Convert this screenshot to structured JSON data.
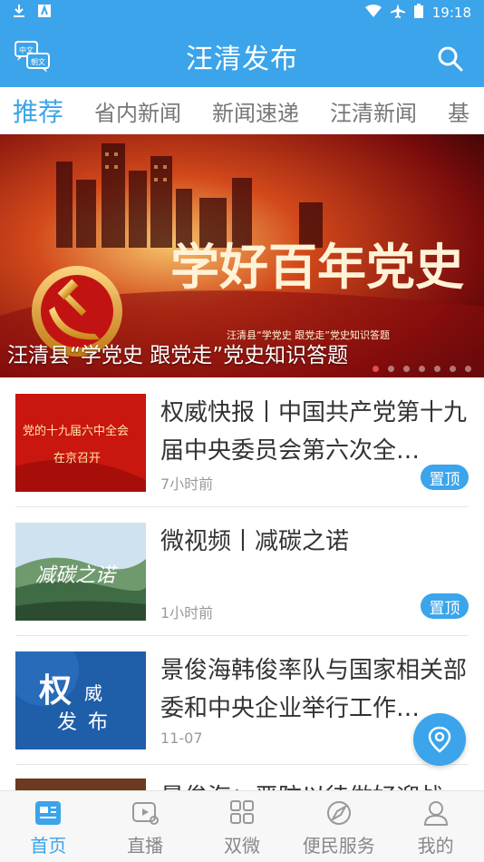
{
  "status_bar": {
    "time": "19:18"
  },
  "app": {
    "title": "汪清发布"
  },
  "tabs": [
    {
      "label": "推荐",
      "active": true
    },
    {
      "label": "省内新闻",
      "active": false
    },
    {
      "label": "新闻速递",
      "active": false
    },
    {
      "label": "汪清新闻",
      "active": false
    },
    {
      "label": "基",
      "active": false
    }
  ],
  "banner": {
    "caption": "汪清县“学党史 跟党走”党史知识答题",
    "art_title": "学好百年党史",
    "art_subtitle": "汪清县“学党史 跟党走”党史知识答题",
    "dots": 7,
    "active_dot": 0
  },
  "lang_icon": {
    "top": "中文",
    "bottom": "朝文"
  },
  "news": [
    {
      "headline": "权威快报丨中国共产党第十九届中央委员会第六次全…",
      "time": "7小时前",
      "pinned": true,
      "pin_label": "置顶",
      "thumb_text": [
        "党的十九届六中全会",
        "在京召开"
      ]
    },
    {
      "headline": "微视频丨减碳之诺",
      "time": "1小时前",
      "pinned": true,
      "pin_label": "置顶",
      "thumb_text": [
        "减碳之诺"
      ]
    },
    {
      "headline": "景俊海韩俊率队与国家相关部委和中央企业举行工作…",
      "time": "11-07",
      "pinned": false,
      "thumb_text": [
        "权",
        "威",
        "发",
        "布"
      ]
    },
    {
      "headline": "景俊海：严防以待做好迎战",
      "time": "",
      "pinned": false
    }
  ],
  "bottom_nav": [
    {
      "label": "首页",
      "icon": "home-news-icon",
      "active": true
    },
    {
      "label": "直播",
      "icon": "live-video-icon",
      "active": false
    },
    {
      "label": "双微",
      "icon": "grid-icon",
      "active": false
    },
    {
      "label": "便民服务",
      "icon": "compass-service-icon",
      "active": false
    },
    {
      "label": "我的",
      "icon": "user-icon",
      "active": false
    }
  ],
  "colors": {
    "primary": "#3ba4ea",
    "banner_red": "#b51212",
    "pin": "#3ba4ea"
  }
}
